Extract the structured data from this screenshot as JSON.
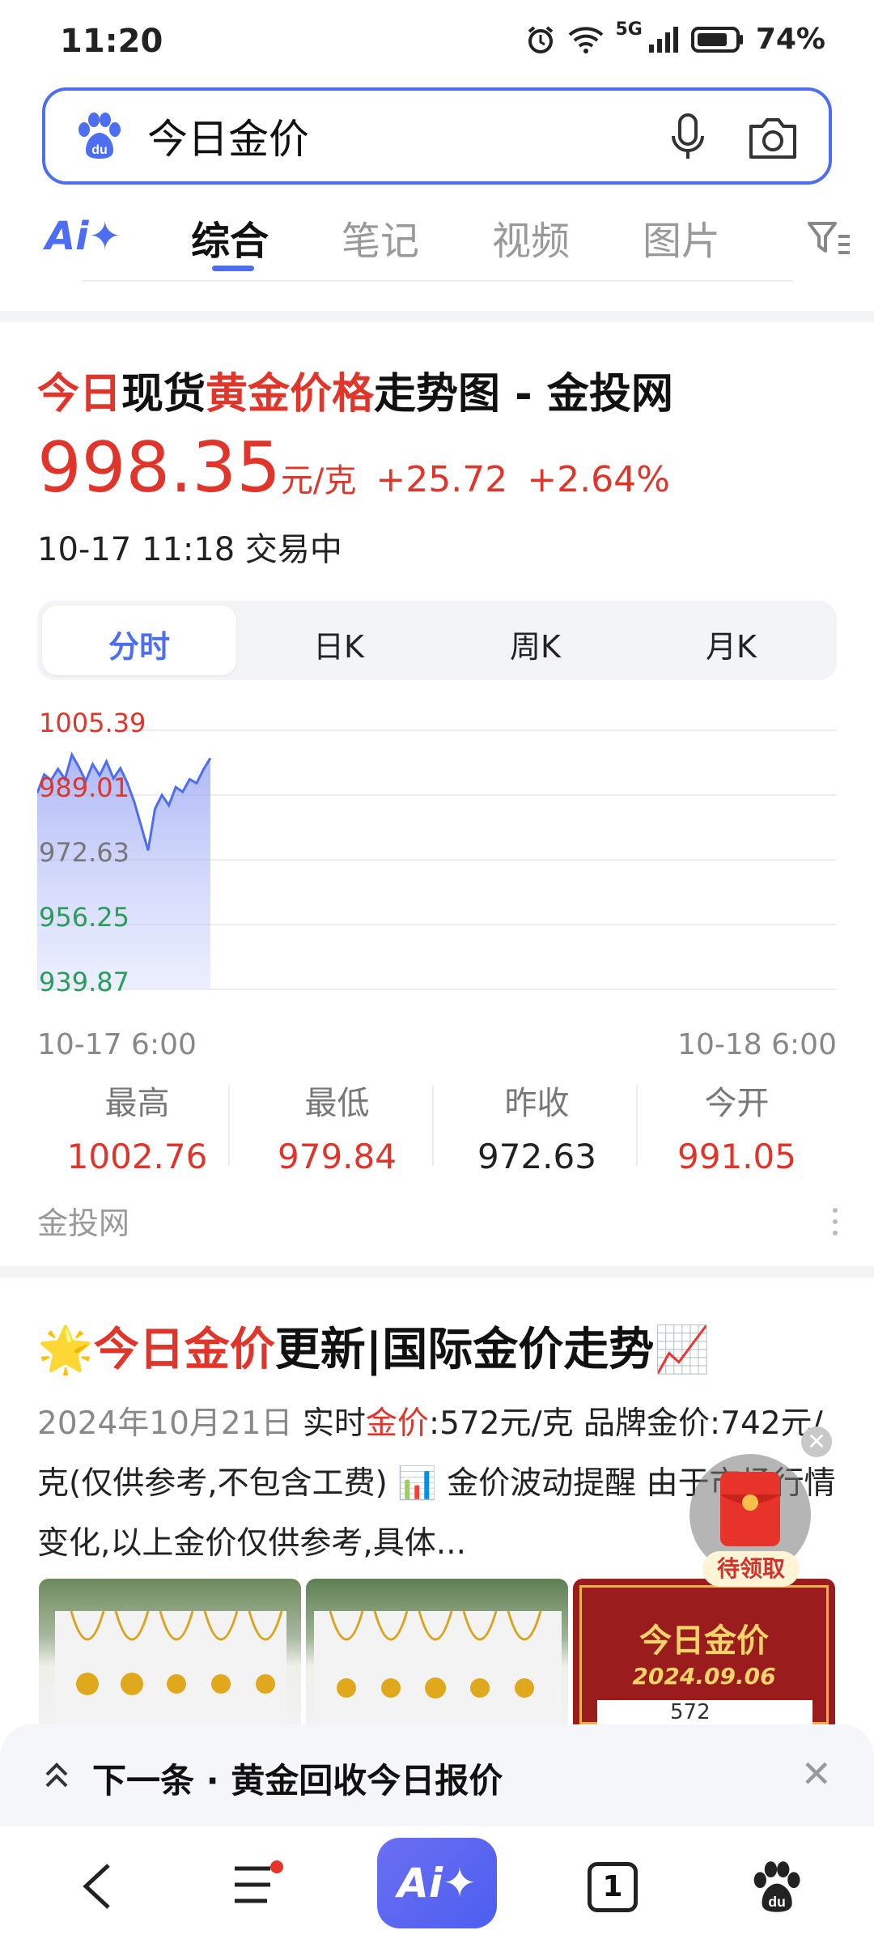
{
  "status": {
    "time": "11:20",
    "network": "5G",
    "battery": "74%"
  },
  "search": {
    "query": "今日金价"
  },
  "tabs": {
    "ai": "Ai✦",
    "items": [
      "综合",
      "笔记",
      "视频",
      "图片"
    ]
  },
  "card1": {
    "title_parts": [
      "今日",
      "现货",
      "黄金价格",
      "走势图 - 金投网"
    ],
    "price": "998.35",
    "unit": "元/克",
    "change": "+25.72",
    "change_pct": "+2.64%",
    "timestamp": "10-17 11:18 交易中",
    "segments": [
      "分时",
      "日K",
      "周K",
      "月K"
    ],
    "chart_data": {
      "type": "area",
      "y_ticks": [
        "1005.39",
        "989.01",
        "972.63",
        "956.25",
        "939.87"
      ],
      "ylim": [
        939.87,
        1005.39
      ],
      "x_start": "10-17 6:00",
      "x_end": "10-18 6:00",
      "series": [
        {
          "values": [
            989.5,
            994.2,
            992.8,
            995.6,
            993.0,
            999.2,
            996.1,
            992.5,
            996.8,
            994.0,
            997.5,
            993.2,
            995.8,
            992.1,
            987.3,
            981.2,
            975.0,
            985.5,
            989.0,
            986.4,
            991.0,
            989.8,
            993.0,
            992.0,
            995.5,
            998.35
          ]
        }
      ]
    },
    "stats": [
      {
        "label": "最高",
        "value": "1002.76"
      },
      {
        "label": "最低",
        "value": "979.84"
      },
      {
        "label": "昨收",
        "value": "972.63"
      },
      {
        "label": "今开",
        "value": "991.05"
      }
    ],
    "source": "金投网"
  },
  "card2": {
    "title_prefix": "今日金价",
    "title_rest": "更新|国际金价走势",
    "body_date": "2024年10月21日",
    "body_1": " 实时",
    "body_kw": "金价",
    "body_2": ":572元/克 品牌金价:742元/克(仅供参考,不包含工费) 📊 金价波动提醒 由于市场行情变化,以上金价仅供参考,具体...",
    "image3_title": "今日金价",
    "image3_date": "2024.09.06",
    "image3_num": "572"
  },
  "packet": {
    "label": "待领取"
  },
  "nextbar": {
    "text": "下一条 · 黄金回收今日报价"
  },
  "bottom_nav": {
    "ai": "Ai✦",
    "tab_count": "1"
  },
  "colors": {
    "accent": "#4e6ef2",
    "up": "#e0352b",
    "down": "#2a9d5c"
  }
}
